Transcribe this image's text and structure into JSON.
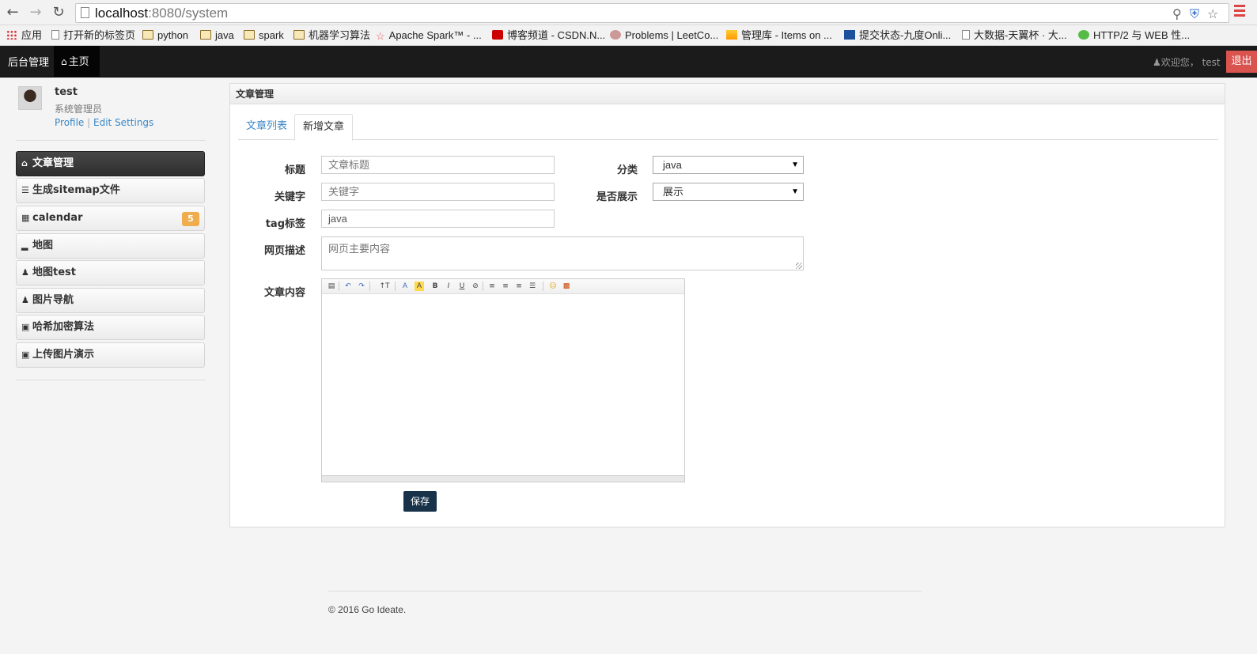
{
  "browser": {
    "url_host": "localhost",
    "url_port_path": ":8080/system",
    "bookmarks": [
      {
        "label": "应用",
        "icon": "apps-grid-icon"
      },
      {
        "label": "打开新的标签页",
        "icon": "page-icon"
      },
      {
        "label": "python",
        "icon": "folder-icon"
      },
      {
        "label": "java",
        "icon": "folder-icon"
      },
      {
        "label": "spark",
        "icon": "folder-icon"
      },
      {
        "label": "机器学习算法",
        "icon": "folder-icon"
      },
      {
        "label": "Apache Spark™ - ...",
        "icon": "spark-star-icon"
      },
      {
        "label": "博客频道 - CSDN.N...",
        "icon": "csdn-icon"
      },
      {
        "label": "Problems | LeetCo...",
        "icon": "leetcode-icon"
      },
      {
        "label": "管理库 - Items on ...",
        "icon": "flag-icon"
      },
      {
        "label": "提交状态-九度Onli...",
        "icon": "jiudu-icon"
      },
      {
        "label": "大数据-天翼杯 · 大...",
        "icon": "page-icon"
      },
      {
        "label": "HTTP/2 与 WEB 性...",
        "icon": "avatar-face-icon"
      }
    ]
  },
  "navbar": {
    "brand": "后台管理",
    "home": "主页",
    "welcome": "欢迎您，  test",
    "logout": "退出"
  },
  "user": {
    "name": "test",
    "role": "系统管理员",
    "profile": "Profile",
    "separator": "|",
    "edit": "Edit Settings"
  },
  "sidebar": {
    "items": [
      {
        "label": "文章管理",
        "icon": "home-icon",
        "active": true
      },
      {
        "label": "生成sitemap文件",
        "icon": "list-icon"
      },
      {
        "label": "calendar",
        "icon": "grid-icon",
        "badge": "5"
      },
      {
        "label": "地图",
        "icon": "signal-icon"
      },
      {
        "label": "地图test",
        "icon": "user-icon"
      },
      {
        "label": "图片导航",
        "icon": "user-icon"
      },
      {
        "label": "哈希加密算法",
        "icon": "lock-icon"
      },
      {
        "label": "上传图片演示",
        "icon": "lock-icon"
      }
    ]
  },
  "panel": {
    "title": "文章管理",
    "tabs": [
      "文章列表",
      "新增文章"
    ]
  },
  "form": {
    "title_label": "标题",
    "title_placeholder": "文章标题",
    "keywords_label": "关键字",
    "keywords_placeholder": "关键字",
    "tag_label": "tag标签",
    "tag_value": "java",
    "desc_label": "网页描述",
    "desc_placeholder": "网页主要内容",
    "content_label": "文章内容",
    "category_label": "分类",
    "category_value": "java",
    "show_label": "是否展示",
    "show_value": "展示",
    "save": "保存"
  },
  "footer": {
    "text": "© 2016 Go Ideate."
  },
  "colors": {
    "navbar": "#1b1b1b",
    "logout": "#d9534f",
    "badge": "#f0ad4e",
    "link": "#3a87c7",
    "save": "#173249"
  }
}
